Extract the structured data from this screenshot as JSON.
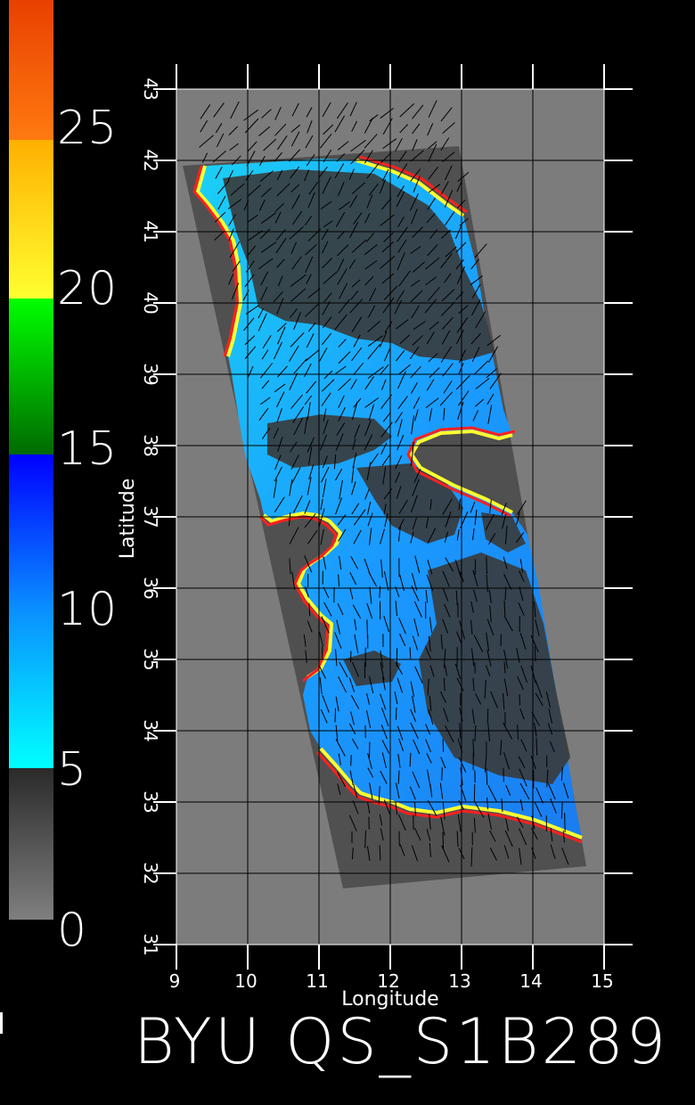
{
  "title": "BYU QS_S1B289",
  "colorbar": {
    "labels": [
      "0",
      "5",
      "10",
      "15",
      "20",
      "25"
    ],
    "colors": {
      "gray_low": "#7f7f7f",
      "gray_high": "#2a2a2a",
      "cyan": "#00ffff",
      "mid_blue": "#0a90ff",
      "blue": "#0000ff",
      "green": "#00ff00",
      "dark_green": "#006a00",
      "yellow": "#ffff30",
      "gold": "#ffb000",
      "orange": "#ff7a10",
      "red_orange": "#e84000"
    }
  },
  "map": {
    "xlabel": "Longitude",
    "ylabel": "Latitude",
    "lon_ticks": [
      "9",
      "10",
      "11",
      "12",
      "13",
      "14",
      "15"
    ],
    "lat_ticks": [
      "31",
      "32",
      "33",
      "34",
      "35",
      "36",
      "37",
      "38",
      "39",
      "40",
      "41",
      "42",
      "43"
    ],
    "lon_range": [
      9,
      15
    ],
    "lat_range": [
      31,
      43
    ],
    "colors": {
      "background_gray": "#7c7c7c",
      "swath_dark": "#505050",
      "land_dark": "#3a3a3a",
      "ocean_cyan": "#18c8f0",
      "ocean_blue": "#1a8cff",
      "grid": "#000000",
      "wind_vector": "#000000"
    }
  }
}
